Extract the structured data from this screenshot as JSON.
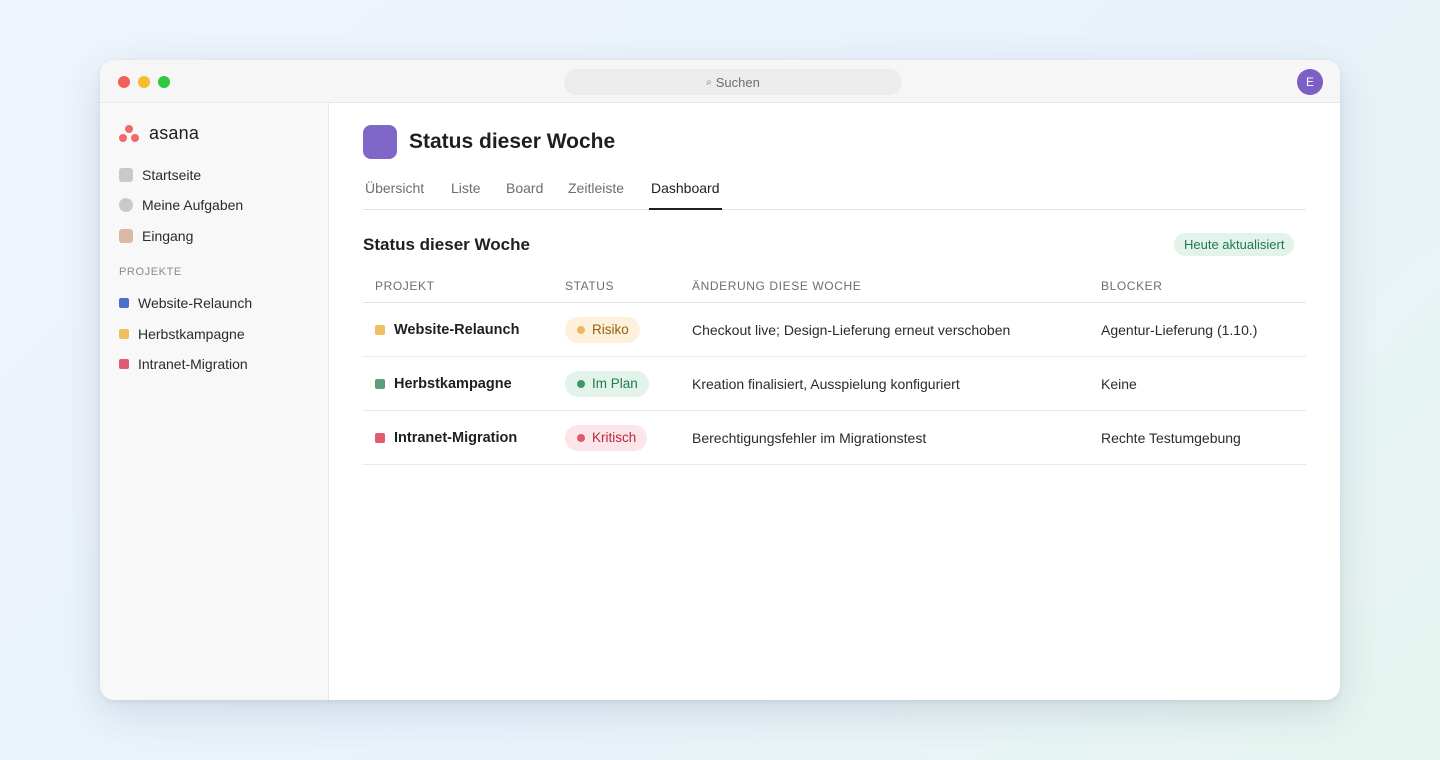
{
  "window": {
    "search_placeholder": "Suchen",
    "avatar_initial": "E"
  },
  "sidebar": {
    "brand": "asana",
    "items": [
      {
        "label": "Startseite",
        "icon": "home-icon",
        "color": "#c9c9cb"
      },
      {
        "label": "Meine Aufgaben",
        "icon": "tasks-icon",
        "color": "#c9c9cb"
      },
      {
        "label": "Eingang",
        "icon": "inbox-icon",
        "color": "#d9b8a6"
      }
    ],
    "section_label": "PROJEKTE",
    "projects": [
      {
        "label": "Website-Relaunch",
        "color": "#4a6fc9"
      },
      {
        "label": "Herbstkampagne",
        "color": "#f0c060"
      },
      {
        "label": "Intranet-Migration",
        "color": "#e05a70"
      }
    ]
  },
  "header": {
    "title": "Status dieser Woche",
    "icon_color": "#7e67c8"
  },
  "tabs": [
    {
      "label": "Übersicht",
      "active": false
    },
    {
      "label": "Liste",
      "active": false
    },
    {
      "label": "Board",
      "active": false
    },
    {
      "label": "Zeitleiste",
      "active": false
    },
    {
      "label": "Dashboard",
      "active": true
    }
  ],
  "section": {
    "title": "Status dieser Woche",
    "updated_badge": "Heute aktualisiert"
  },
  "table": {
    "columns": [
      "PROJEKT",
      "STATUS",
      "ÄNDERUNG DIESE WOCHE",
      "BLOCKER"
    ],
    "rows": [
      {
        "project": "Website-Relaunch",
        "project_color": "#f0c060",
        "status": "Risiko",
        "status_bg": "#fdf1dc",
        "status_fg": "#9a5b12",
        "status_dot": "#f0b65a",
        "change": "Checkout live; Design-Lieferung erneut verschoben",
        "blocker": "Agentur-Lieferung (1.10.)"
      },
      {
        "project": "Herbstkampagne",
        "project_color": "#5a9e7c",
        "status": "Im Plan",
        "status_bg": "#e3f3ea",
        "status_fg": "#1f7a4f",
        "status_dot": "#3f9468",
        "change": "Kreation finalisiert, Ausspielung konfiguriert",
        "blocker": "Keine"
      },
      {
        "project": "Intranet-Migration",
        "project_color": "#e05a70",
        "status": "Kritisch",
        "status_bg": "#fce5e8",
        "status_fg": "#b8283e",
        "status_dot": "#e05a70",
        "change": "Berechtigungsfehler im Migrationstest",
        "blocker": "Rechte Testumgebung"
      }
    ]
  }
}
